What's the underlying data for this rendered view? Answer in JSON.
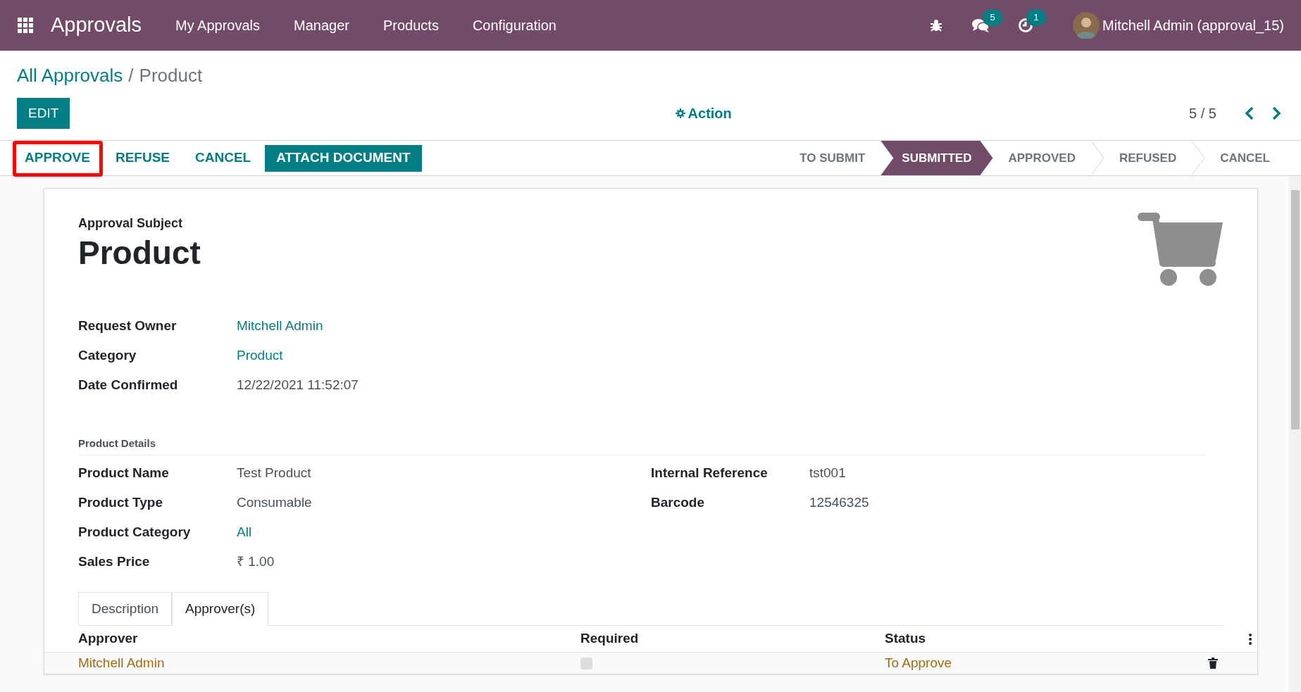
{
  "navbar": {
    "app_title": "Approvals",
    "menu": [
      "My Approvals",
      "Manager",
      "Products",
      "Configuration"
    ],
    "messages_count": "5",
    "activities_count": "1",
    "user": "Mitchell Admin (approval_15)"
  },
  "breadcrumb_separator": "/",
  "breadcrumb": [
    {
      "label": "All Approvals",
      "kind": "link"
    },
    {
      "label": "Product",
      "kind": "current"
    }
  ],
  "edit_button": "EDIT",
  "action_menu": "Action",
  "pager": "5 / 5",
  "buttons": [
    {
      "label": "APPROVE",
      "primary": false,
      "highlighted": true
    },
    {
      "label": "REFUSE",
      "primary": false,
      "highlighted": false
    },
    {
      "label": "CANCEL",
      "primary": false,
      "highlighted": false
    },
    {
      "label": "ATTACH DOCUMENT",
      "primary": true,
      "highlighted": false
    }
  ],
  "stages": [
    {
      "label": "TO SUBMIT",
      "selected": false
    },
    {
      "label": "SUBMITTED",
      "selected": true
    },
    {
      "label": "APPROVED",
      "selected": false
    },
    {
      "label": "REFUSED",
      "selected": false
    },
    {
      "label": "CANCEL",
      "selected": false
    }
  ],
  "form": {
    "subject_label": "Approval Subject",
    "subject": "Product",
    "fields": [
      {
        "label": "Request Owner",
        "value": "Mitchell Admin",
        "kind": "link"
      },
      {
        "label": "Category",
        "value": "Product",
        "kind": "link"
      },
      {
        "label": "Date Confirmed",
        "value": "12/22/2021 11:52:07",
        "kind": "text"
      }
    ],
    "section_title": "Product Details",
    "left_fields": [
      {
        "label": "Product Name",
        "value": "Test Product",
        "kind": "text"
      },
      {
        "label": "Product Type",
        "value": "Consumable",
        "kind": "text"
      },
      {
        "label": "Product Category",
        "value": "All",
        "kind": "link"
      },
      {
        "label": "Sales Price",
        "value": "₹ 1.00",
        "kind": "text"
      }
    ],
    "right_fields": [
      {
        "label": "Internal Reference",
        "value": "tst001",
        "kind": "text"
      },
      {
        "label": "Barcode",
        "value": "12546325",
        "kind": "text"
      }
    ]
  },
  "tabs": [
    {
      "label": "Description",
      "selected": false
    },
    {
      "label": "Approver(s)",
      "selected": true
    }
  ],
  "table": {
    "columns": [
      "Approver",
      "Required",
      "Status"
    ],
    "rows": [
      {
        "approver": "Mitchell Admin",
        "required": false,
        "status": "To Approve"
      }
    ]
  }
}
